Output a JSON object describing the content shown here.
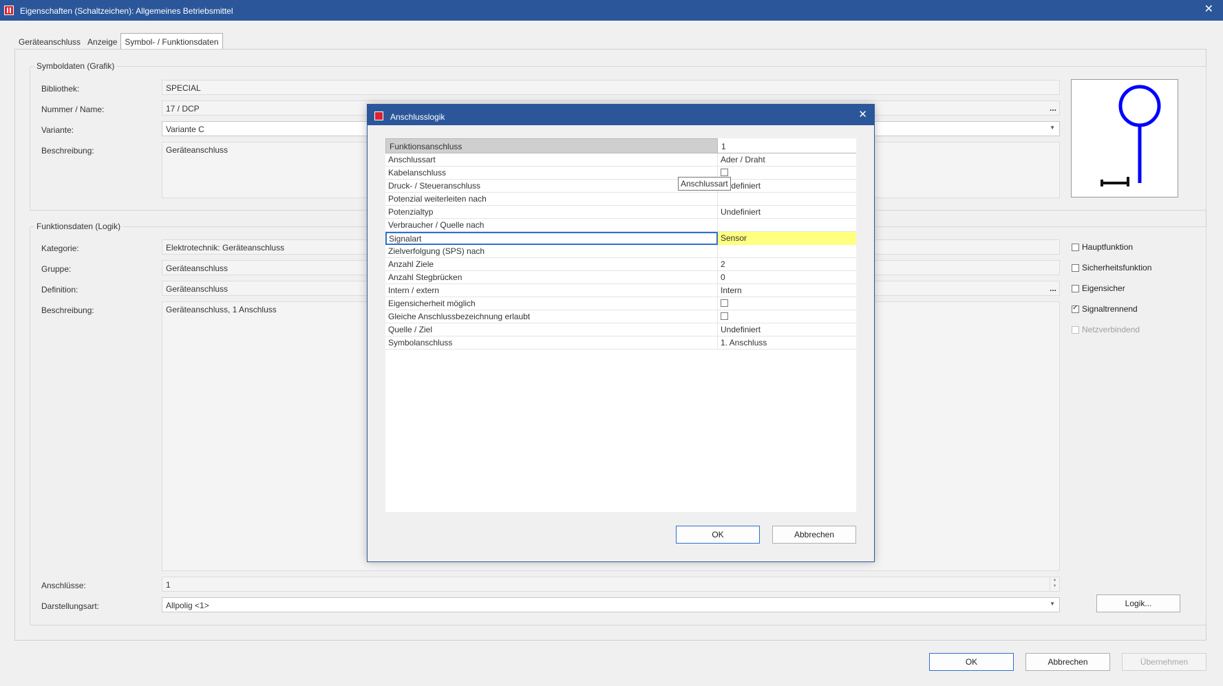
{
  "window": {
    "title": "Eigenschaften (Schaltzeichen): Allgemeines Betriebsmittel",
    "close": "✕"
  },
  "tabs": [
    "Geräteanschluss",
    "Anzeige",
    "Symbol- / Funktionsdaten"
  ],
  "symbol_group": {
    "title": "Symboldaten (Grafik)",
    "bibliothek_label": "Bibliothek:",
    "bibliothek_value": "SPECIAL",
    "nummer_label": "Nummer / Name:",
    "nummer_value": "17 / DCP",
    "variante_label": "Variante:",
    "variante_value": "Variante C",
    "beschreibung_label": "Beschreibung:",
    "beschreibung_value": "Geräteanschluss"
  },
  "function_group": {
    "title": "Funktionsdaten (Logik)",
    "kategorie_label": "Kategorie:",
    "kategorie_value": "Elektrotechnik: Geräteanschluss",
    "gruppe_label": "Gruppe:",
    "gruppe_value": "Geräteanschluss",
    "definition_label": "Definition:",
    "definition_value": "Geräteanschluss",
    "beschreibung_label": "Beschreibung:",
    "beschreibung_value": "Geräteanschluss, 1 Anschluss",
    "anschluesse_label": "Anschlüsse:",
    "anschluesse_value": "1",
    "darstellungsart_label": "Darstellungsart:",
    "darstellungsart_value": "Allpolig <1>"
  },
  "checkboxes": [
    {
      "label": "Hauptfunktion",
      "checked": false,
      "enabled": true
    },
    {
      "label": "Sicherheitsfunktion",
      "checked": false,
      "enabled": true
    },
    {
      "label": "Eigensicher",
      "checked": false,
      "enabled": true
    },
    {
      "label": "Signaltrennend",
      "checked": true,
      "enabled": true
    },
    {
      "label": "Netzverbindend",
      "checked": false,
      "enabled": false
    }
  ],
  "logik_button": "Logik...",
  "ellipsis": "...",
  "footer": {
    "ok": "OK",
    "cancel": "Abbrechen",
    "apply": "Übernehmen"
  },
  "modal": {
    "title": "Anschlusslogik",
    "header_name": "Funktionsanschluss",
    "header_value": "1",
    "rows": [
      {
        "name": "Anschlussart",
        "value": "Ader / Draht",
        "type": "text"
      },
      {
        "name": "Kabelanschluss",
        "value": "",
        "type": "checkbox"
      },
      {
        "name": "Druck- / Steueranschluss",
        "value": "Undefiniert",
        "type": "text"
      },
      {
        "name": "Potenzial weiterleiten nach",
        "value": "",
        "type": "text"
      },
      {
        "name": "Potenzialtyp",
        "value": "Undefiniert",
        "type": "text"
      },
      {
        "name": "Verbraucher / Quelle nach",
        "value": "",
        "type": "text"
      },
      {
        "name": "Signalart",
        "value": "Sensor",
        "type": "text",
        "selected": true
      },
      {
        "name": "Zielverfolgung (SPS) nach",
        "value": "",
        "type": "text"
      },
      {
        "name": "Anzahl Ziele",
        "value": "2",
        "type": "text"
      },
      {
        "name": "Anzahl Stegbrücken",
        "value": "0",
        "type": "text"
      },
      {
        "name": "Intern / extern",
        "value": "Intern",
        "type": "text"
      },
      {
        "name": "Eigensicherheit möglich",
        "value": "",
        "type": "checkbox"
      },
      {
        "name": "Gleiche Anschlussbezeichnung erlaubt",
        "value": "",
        "type": "checkbox"
      },
      {
        "name": "Quelle / Ziel",
        "value": "Undefiniert",
        "type": "text"
      },
      {
        "name": "Symbolanschluss",
        "value": "1. Anschluss",
        "type": "text"
      }
    ],
    "ok": "OK",
    "cancel": "Abbrechen",
    "tooltip": "Anschlussart"
  },
  "colors": {
    "titlebar": "#2b579a",
    "selection": "#ffff80",
    "symbol": "#0000ff"
  }
}
